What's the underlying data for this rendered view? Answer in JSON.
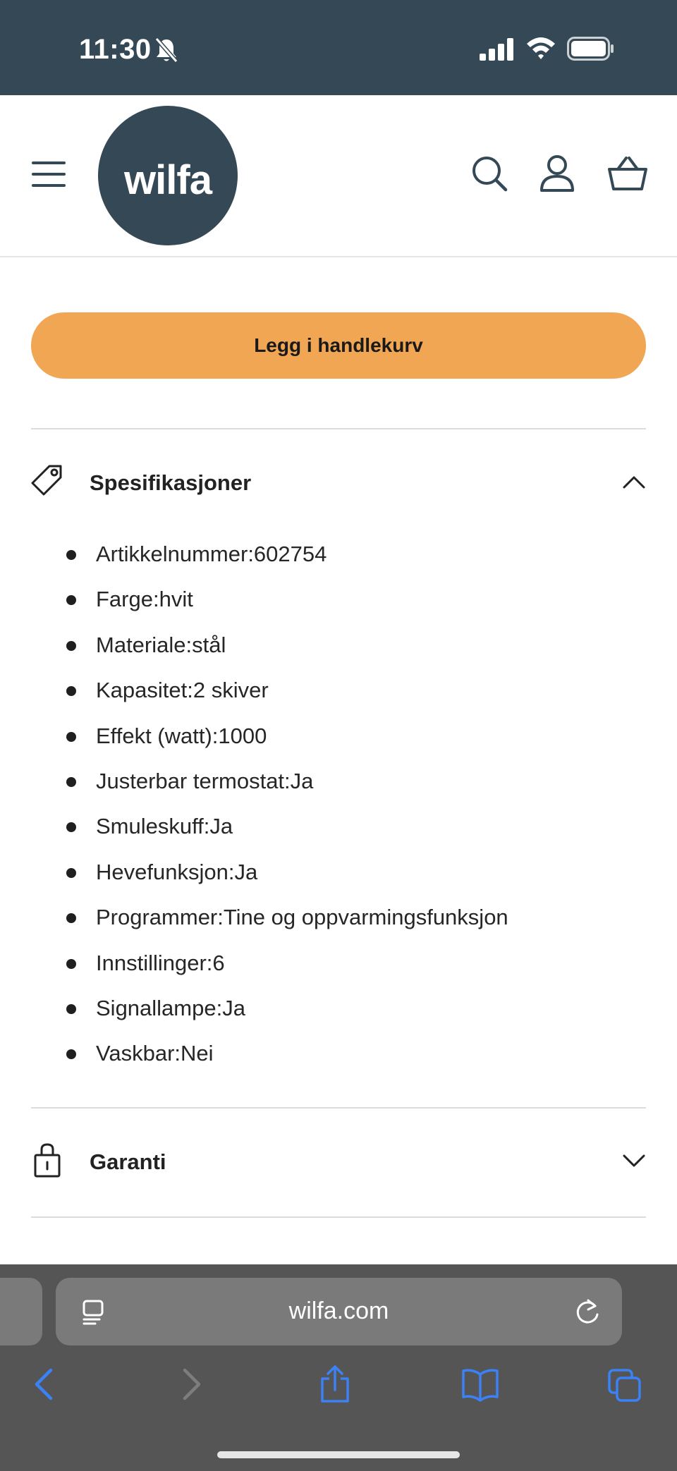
{
  "status_bar": {
    "time": "11:30"
  },
  "header": {
    "logo_text": "wilfa"
  },
  "product": {
    "add_to_cart_label": "Legg i handlekurv"
  },
  "specifications": {
    "title": "Spesifikasjoner",
    "items": [
      "Artikkelnummer:602754",
      "Farge:hvit",
      "Materiale:stål",
      "Kapasitet:2 skiver",
      "Effekt (watt):1000",
      "Justerbar termostat:Ja",
      "Smuleskuff:Ja",
      "Hevefunksjon:Ja",
      "Programmer:Tine og oppvarmingsfunksjon",
      "Innstillinger:6",
      "Signallampe:Ja",
      "Vaskbar:Nei"
    ]
  },
  "warranty": {
    "title": "Garanti"
  },
  "browser": {
    "url": "wilfa.com"
  },
  "colors": {
    "brand": "#344955",
    "button": "#f0a653",
    "safari_tint": "#3b82f6"
  }
}
